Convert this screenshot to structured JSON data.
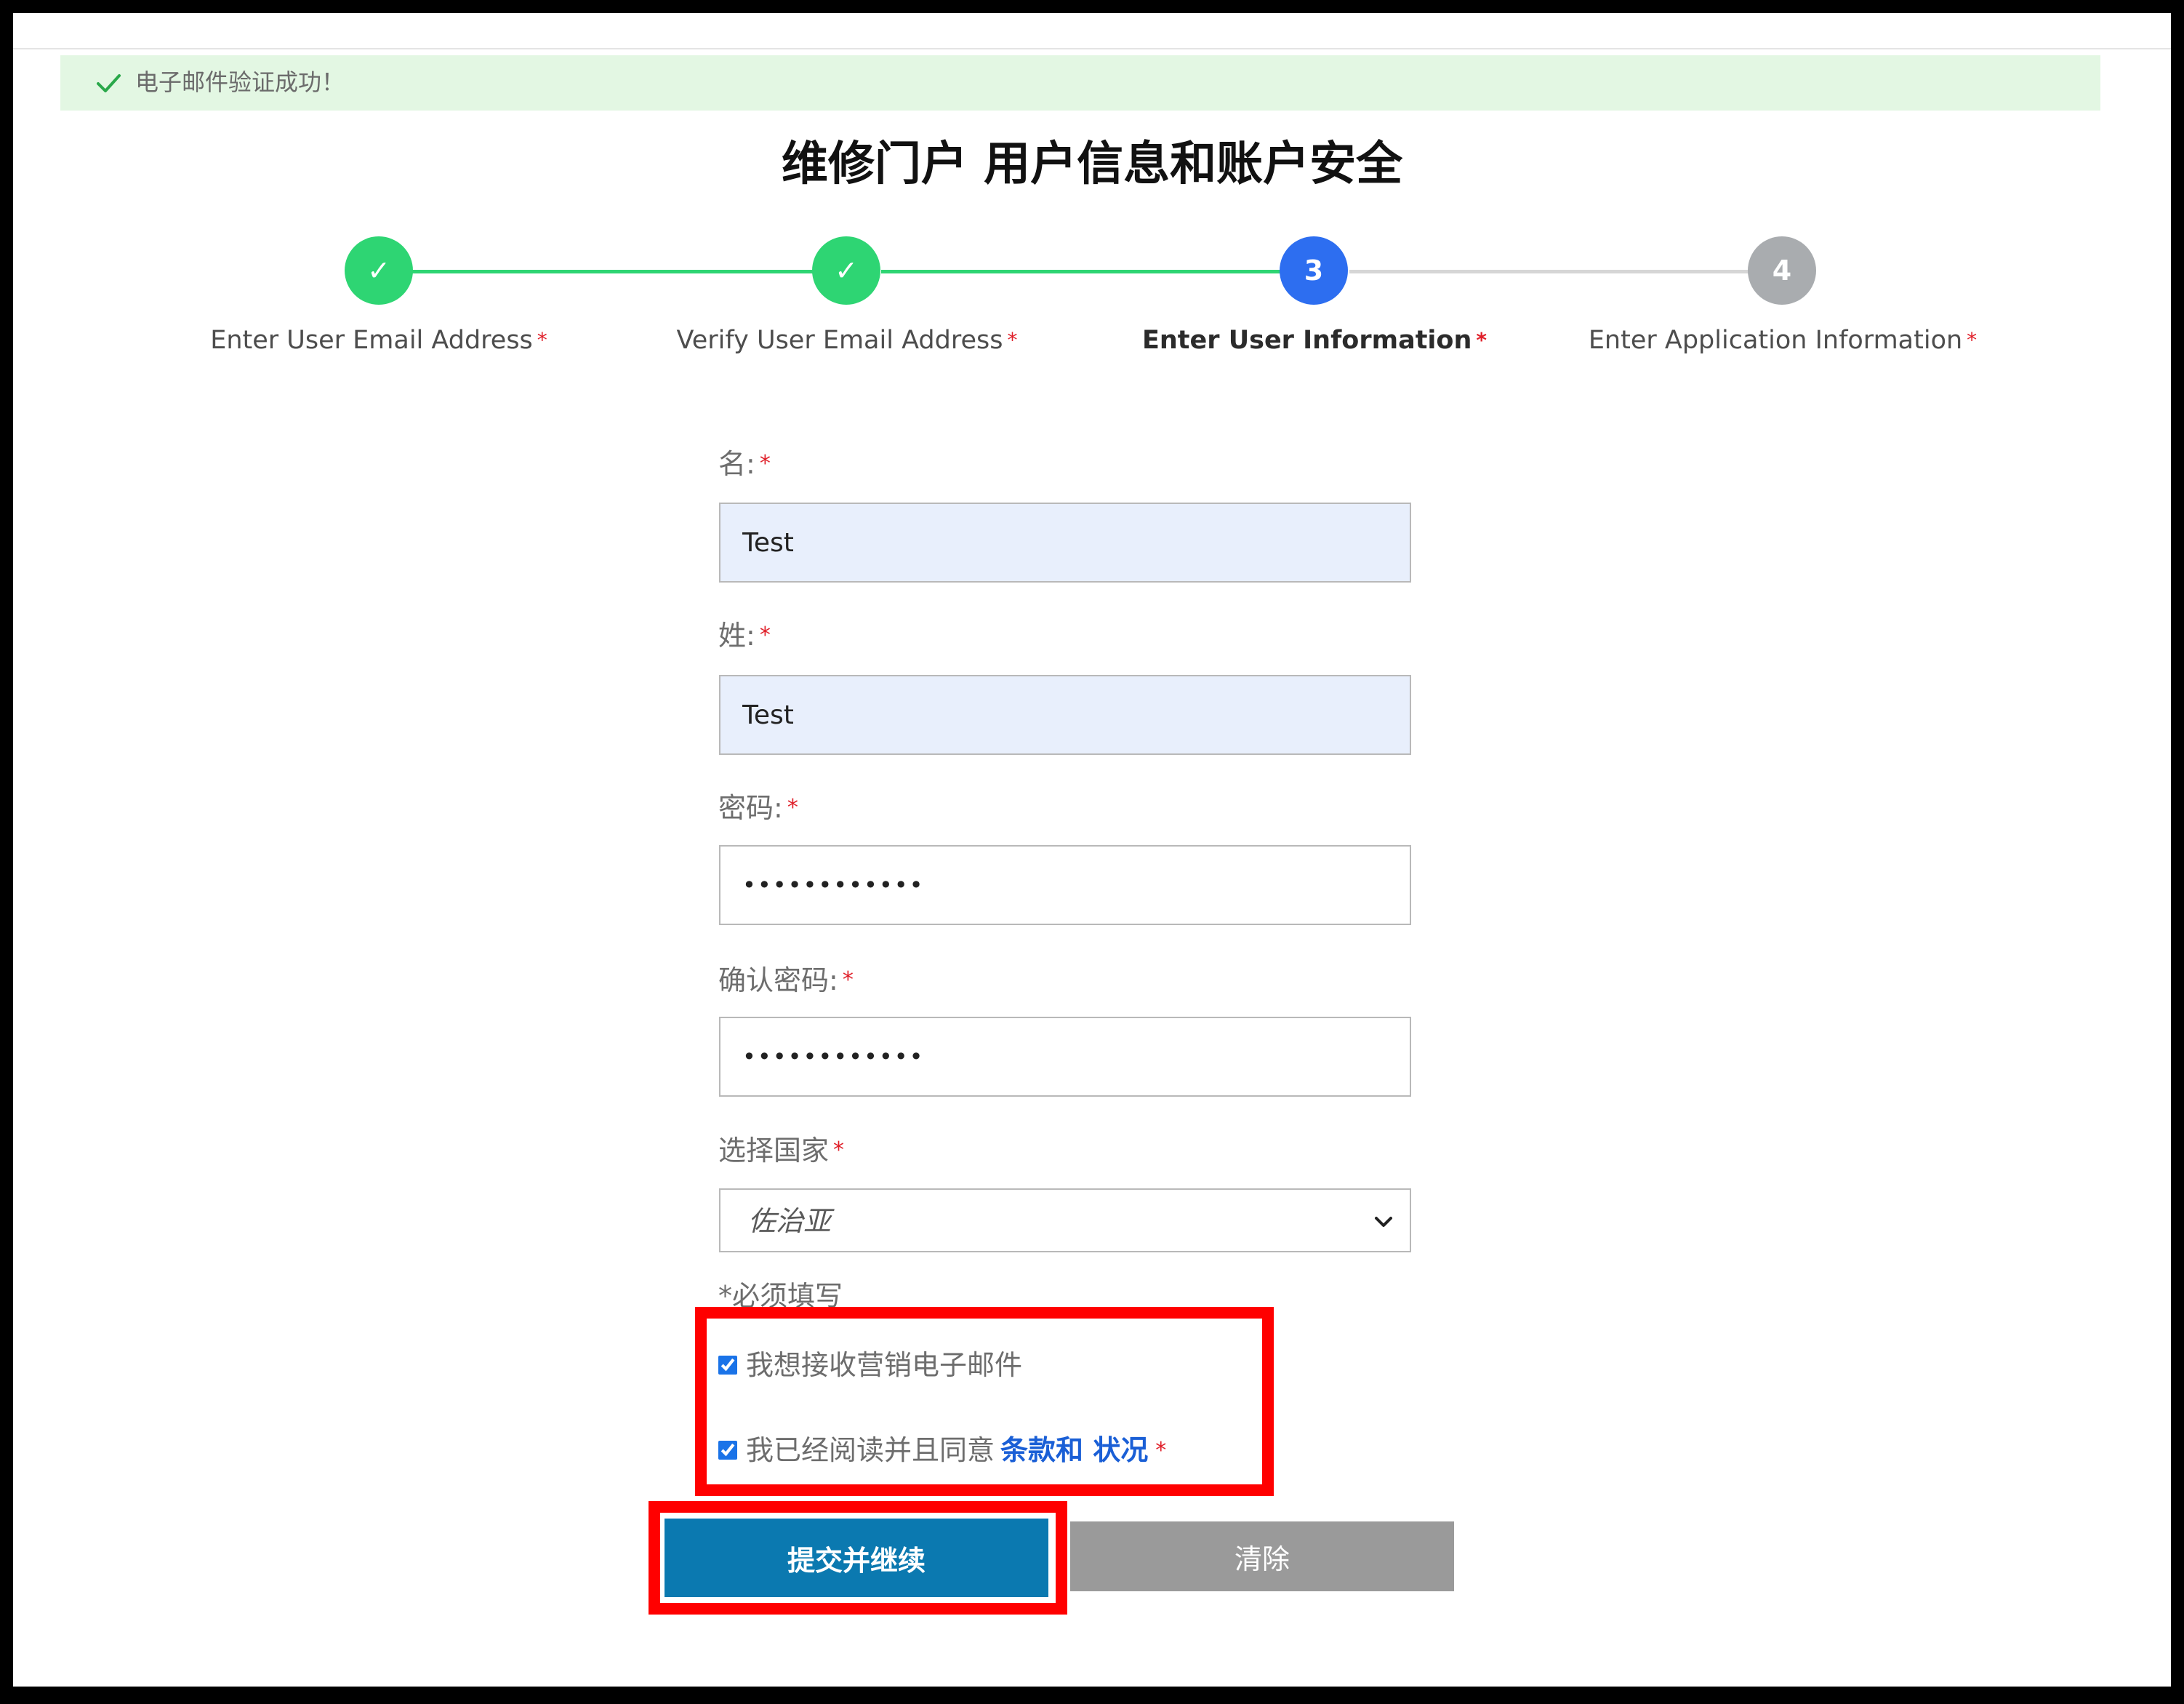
{
  "banner": {
    "icon": "check-icon",
    "text": "电子邮件验证成功！"
  },
  "page": {
    "title": "维修门户 用户信息和账户安全"
  },
  "stepper": {
    "steps": [
      {
        "marker": "✓",
        "label": "Enter User Email Address",
        "state": "complete"
      },
      {
        "marker": "✓",
        "label": "Verify User Email Address",
        "state": "complete"
      },
      {
        "marker": "3",
        "label": "Enter User Information",
        "state": "current"
      },
      {
        "marker": "4",
        "label": "Enter Application Information",
        "state": "pending"
      }
    ],
    "required_mark": "*"
  },
  "form": {
    "first_name": {
      "label": "名:",
      "value": "Test"
    },
    "last_name": {
      "label": "姓:",
      "value": "Test"
    },
    "password": {
      "label": "密码:",
      "value": "••••••••••••"
    },
    "confirm_password": {
      "label": "确认密码:",
      "value": "••••••••••••"
    },
    "country": {
      "label": "选择国家",
      "selected": "佐治亚"
    },
    "required_note": "*必须填写",
    "marketing_opt_in": {
      "label": "我想接收营销电子邮件",
      "checked": true
    },
    "terms": {
      "label": "我已经阅读并且同意",
      "link": "条款和 状况",
      "checked": true
    },
    "submit_label": "提交并继续",
    "clear_label": "清除"
  },
  "colors": {
    "success_green": "#2ed573",
    "current_blue": "#2d6ef0",
    "pending_gray": "#a9acaf",
    "primary_button": "#0b79b0",
    "secondary_button": "#9a9a9a",
    "highlight_red": "#ff0000"
  }
}
